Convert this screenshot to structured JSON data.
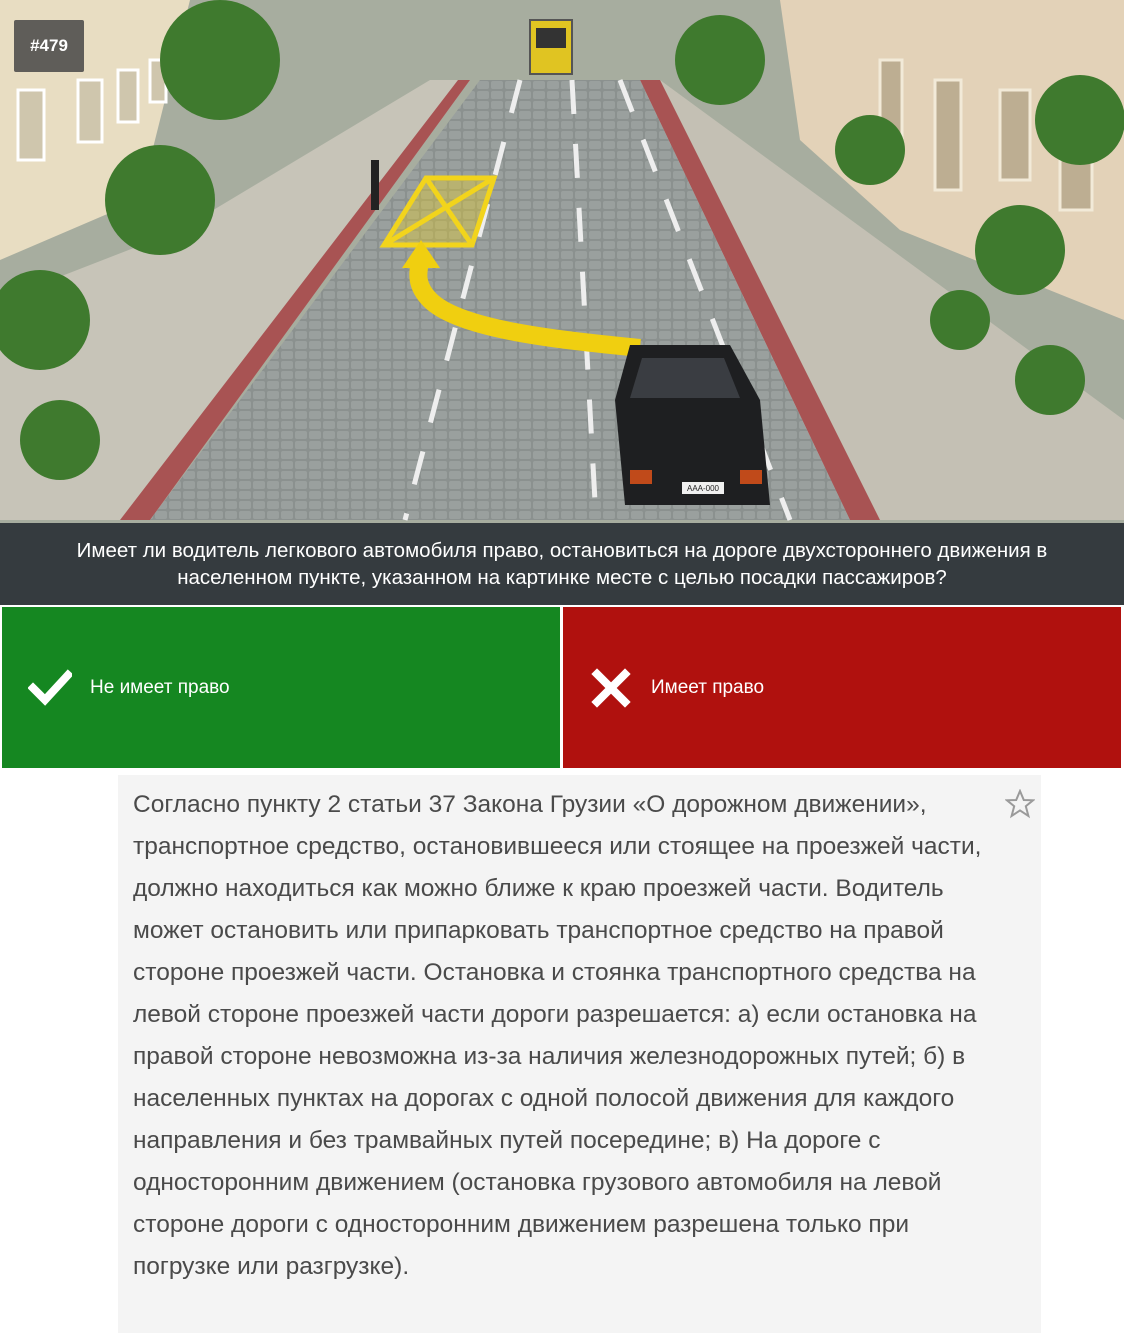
{
  "question": {
    "number": "#479",
    "text": "Имеет ли водитель легкового автомобиля право, остановиться на дороге двухстороннего движения в населенном пункте, указанном на картинке месте с целью посадки пассажиров?"
  },
  "scene": {
    "car_plate": "AAA-000"
  },
  "answers": [
    {
      "label": "Не имеет право",
      "status": "correct",
      "icon": "checkmark-icon",
      "color": "#158721"
    },
    {
      "label": "Имеет право",
      "status": "wrong",
      "icon": "cross-icon",
      "color": "#b0110e"
    }
  ],
  "explanation": {
    "text": "Согласно пункту 2 статьи 37 Закона Грузии «О дорожном движении», транспортное средство, остановившееся или стоящее на проезжей части, должно находиться как можно ближе к краю проезжей части. Водитель может остановить или припарковать транспортное средство на правой стороне проезжей части. Остановка и стоянка транспортного средства на левой стороне проезжей части дороги разрешается: а) если остановка на правой стороне невозможна из-за наличия железнодорожных путей; б) в населенных пунктах на дорогах с одной полосой движения для каждого направления и без трамвайных путей посередине; в) На дороге с односторонним движением (остановка грузового автомобиля на левой стороне дороги с односторонним движением разрешена только при погрузке или разгрузке).",
    "favorite_icon": "star-outline-icon"
  }
}
